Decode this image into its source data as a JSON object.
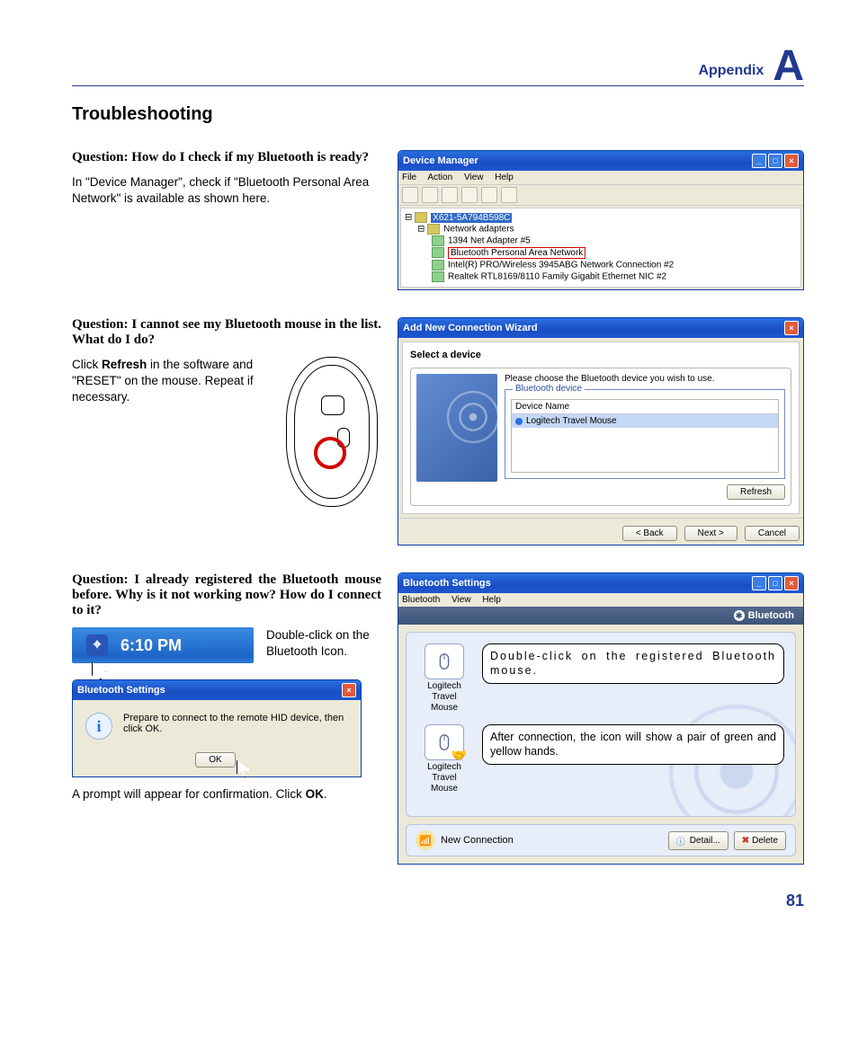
{
  "header": {
    "label": "Appendix",
    "letter": "A"
  },
  "title": "Troubleshooting",
  "page_number": "81",
  "q1": {
    "question": "Question: How do I check if my Bluetooth is ready?",
    "answer": "In \"Device Manager\", check if \"Bluetooth Personal Area Network\" is available as shown here.",
    "devmgr": {
      "title": "Device Manager",
      "menu": [
        "File",
        "Action",
        "View",
        "Help"
      ],
      "root": "X621-5A794B598C",
      "cat": "Network adapters",
      "items": [
        "1394 Net Adapter #5",
        "Bluetooth Personal Area Network",
        "Intel(R) PRO/Wireless 3945ABG Network Connection #2",
        "Realtek RTL8169/8110 Family Gigabit Ethernet NIC #2"
      ]
    }
  },
  "q2": {
    "question": "Question: I cannot see my Bluetooth mouse in the list. What do I do?",
    "answer_pre": "Click ",
    "answer_bold": "Refresh",
    "answer_post": " in the software and \"RESET\" on the mouse. Repeat if necessary.",
    "wizard": {
      "title": "Add New Connection Wizard",
      "subtitle": "Select a device",
      "instruction": "Please choose the Bluetooth device you wish to use.",
      "fieldset": "Bluetooth device",
      "col": "Device Name",
      "row": "Logitech Travel Mouse",
      "refresh": "Refresh",
      "back": "< Back",
      "next": "Next >",
      "cancel": "Cancel"
    }
  },
  "q3": {
    "question": "Question: I already registered the Bluetooth mouse before. Why is it not working now? How do I connect to it?",
    "step1": "Double-click on the Bluetooth Icon.",
    "clock": "6:10 PM",
    "dlg": {
      "title": "Bluetooth Settings",
      "msg": "Prepare to connect to the remote HID device, then click OK.",
      "ok": "OK"
    },
    "confirm_pre": "A prompt will appear for confirmation. Click ",
    "confirm_bold": "OK",
    "confirm_post": ".",
    "btwin": {
      "title": "Bluetooth Settings",
      "menu": [
        "Bluetooth",
        "View",
        "Help"
      ],
      "brand": "Bluetooth",
      "dev1": "Logitech Travel Mouse",
      "dev2": "Logitech Travel Mouse",
      "callout1": "Double-click on the registered Bluetooth mouse.",
      "callout2": "After connection, the icon will show a pair of green and yellow hands.",
      "newconn": "New Connection",
      "detail": "Detail...",
      "delete": "Delete"
    }
  }
}
